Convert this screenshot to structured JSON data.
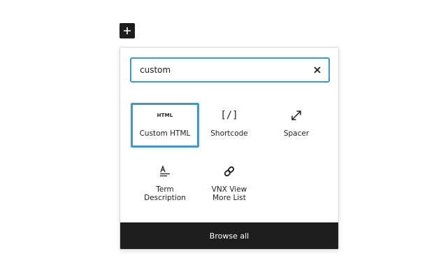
{
  "toggle": {
    "icon": "plus-icon"
  },
  "search": {
    "value": "custom",
    "clear_icon": "close-icon"
  },
  "blocks": [
    {
      "label": "Custom HTML",
      "icon": "html-icon",
      "icon_text": "HTML",
      "selected": true
    },
    {
      "label": "Shortcode",
      "icon": "shortcode-icon",
      "icon_text": "[/]"
    },
    {
      "label": "Spacer",
      "icon": "resize-arrows-icon"
    },
    {
      "label": "Term\nDescription",
      "icon": "term-description-icon"
    },
    {
      "label": "VNX View\nMore List",
      "icon": "link-icon"
    }
  ],
  "footer": {
    "browse_all_label": "Browse all"
  },
  "colors": {
    "accent": "#3a97d8",
    "dark": "#1e1e1e"
  }
}
